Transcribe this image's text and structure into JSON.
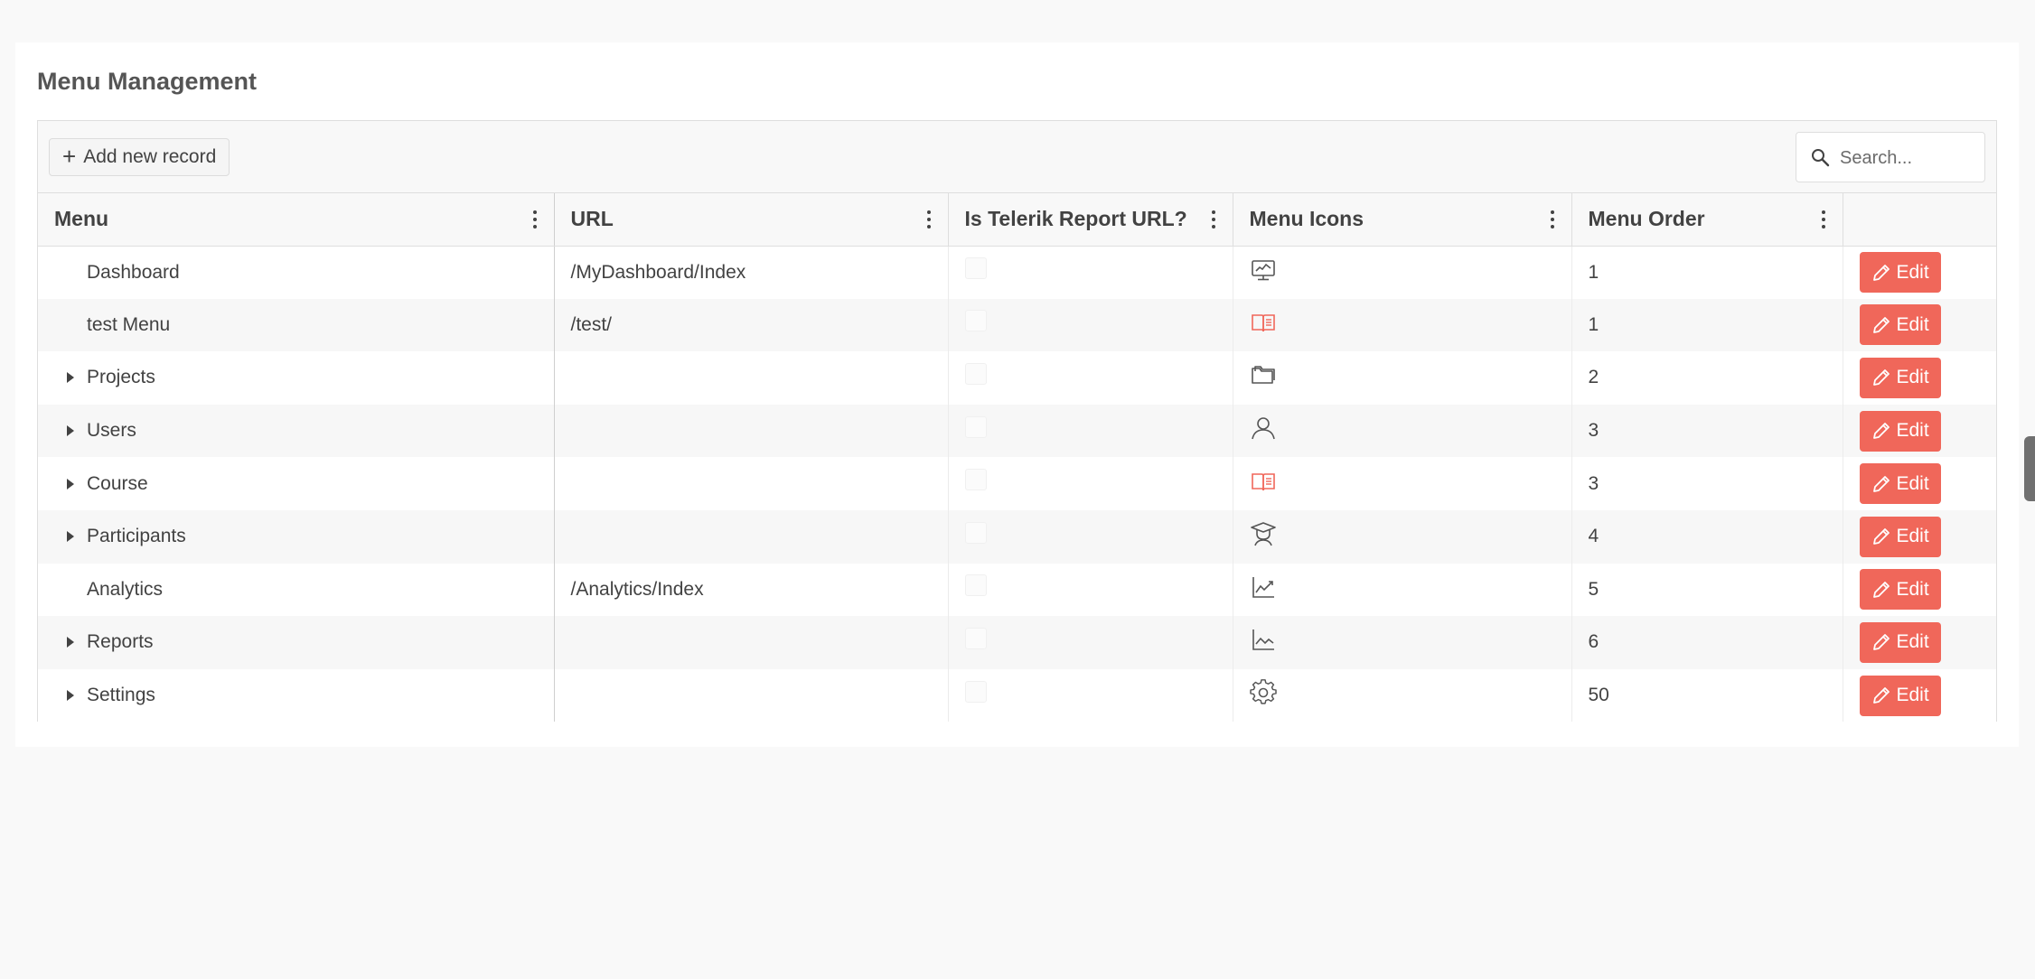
{
  "page": {
    "title": "Menu Management"
  },
  "toolbar": {
    "add_label": "Add new record",
    "search_placeholder": "Search..."
  },
  "columns": {
    "menu": "Menu",
    "url": "URL",
    "telerik": "Is Telerik Report URL?",
    "icons": "Menu Icons",
    "order": "Menu Order"
  },
  "rows": [
    {
      "menu": "Dashboard",
      "expandable": false,
      "url": "/MyDashboard/Index",
      "telerik": false,
      "icon": "monitor-chart-icon",
      "order": "1",
      "edit": "Edit"
    },
    {
      "menu": "test Menu",
      "expandable": false,
      "url": "/test/",
      "telerik": false,
      "icon": "book-icon",
      "order": "1",
      "edit": "Edit"
    },
    {
      "menu": "Projects",
      "expandable": true,
      "url": "",
      "telerik": false,
      "icon": "folder-icon",
      "order": "2",
      "edit": "Edit"
    },
    {
      "menu": "Users",
      "expandable": true,
      "url": "",
      "telerik": false,
      "icon": "user-icon",
      "order": "3",
      "edit": "Edit"
    },
    {
      "menu": "Course",
      "expandable": true,
      "url": "",
      "telerik": false,
      "icon": "book-icon",
      "order": "3",
      "edit": "Edit"
    },
    {
      "menu": "Participants",
      "expandable": true,
      "url": "",
      "telerik": false,
      "icon": "graduate-icon",
      "order": "4",
      "edit": "Edit"
    },
    {
      "menu": "Analytics",
      "expandable": false,
      "url": "/Analytics/Index",
      "telerik": false,
      "icon": "line-chart-icon",
      "order": "5",
      "edit": "Edit"
    },
    {
      "menu": "Reports",
      "expandable": true,
      "url": "",
      "telerik": false,
      "icon": "area-chart-icon",
      "order": "6",
      "edit": "Edit"
    },
    {
      "menu": "Settings",
      "expandable": true,
      "url": "",
      "telerik": false,
      "icon": "gear-icon",
      "order": "50",
      "edit": "Edit"
    }
  ],
  "colors": {
    "accent": "#f0675a",
    "icon_gray": "#555555"
  }
}
